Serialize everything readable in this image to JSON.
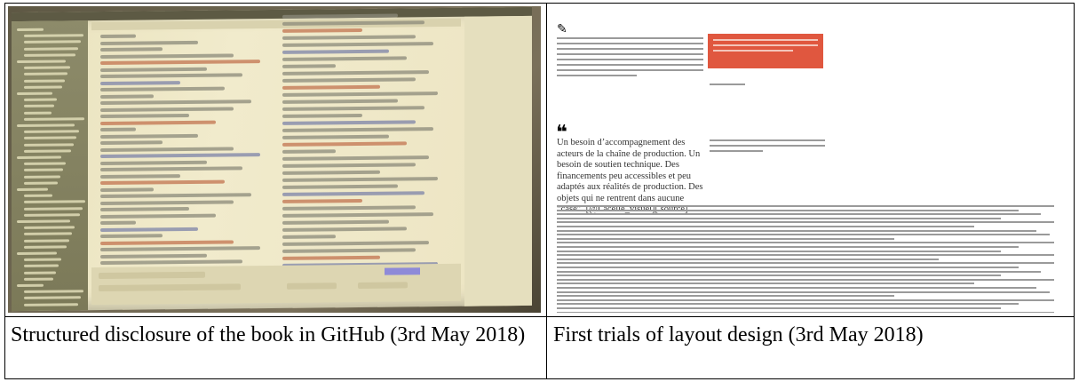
{
  "captions": {
    "left": "Structured disclosure of the book in GitHub (3rd May 2018)",
    "right": "First trials of layout design (3rd May 2018)"
  },
  "layout_page": {
    "pull_quote": "Un besoin d’accompagnement des acteurs de la chaîne de production. Un besoin de soutien technique. Des financements peu accessibles et peu adaptés aux réalités de production. Des objets qui ne rentrent dans aucune “case”. [@Lacelle_visuel][.source]"
  },
  "icons": {
    "left_photo": "photo-of-code-editor",
    "right_page": "layout-page-mockup"
  }
}
